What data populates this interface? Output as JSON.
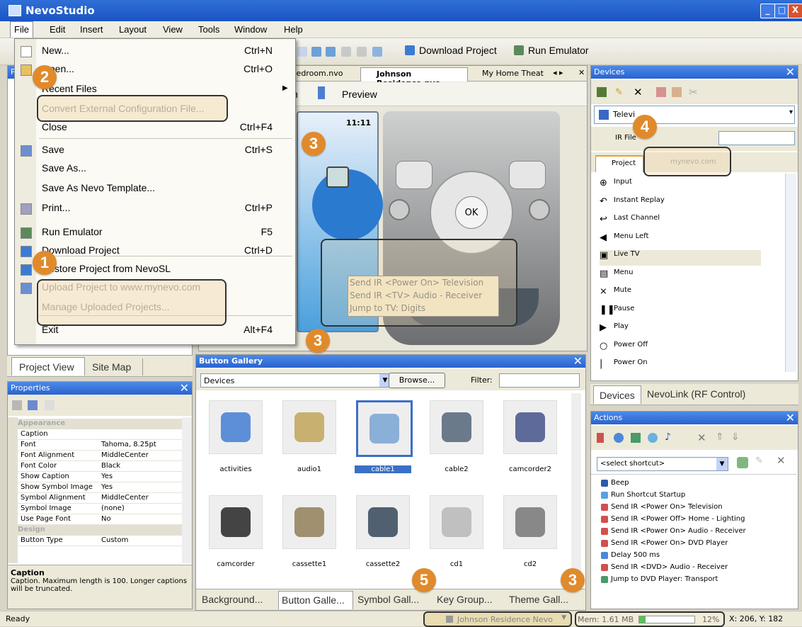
{
  "app": {
    "title": "NevoStudio"
  },
  "window_controls": {
    "minimize": "_",
    "maximize": "□",
    "close": "X"
  },
  "menubar": [
    "File",
    "Edit",
    "Insert",
    "Layout",
    "View",
    "Tools",
    "Window",
    "Help"
  ],
  "toolbar": {
    "download_project": "Download Project",
    "run_emulator": "Run Emulator"
  },
  "file_menu": {
    "items": [
      {
        "label": "New...",
        "shortcut": "Ctrl+N",
        "disabled": false
      },
      {
        "label": "Open...",
        "shortcut": "Ctrl+O",
        "disabled": false
      },
      {
        "label": "Recent Files",
        "shortcut": "",
        "disabled": false
      },
      {
        "label": "Convert External Configuration File...",
        "shortcut": "",
        "disabled": true
      },
      {
        "label": "Close",
        "shortcut": "Ctrl+F4",
        "disabled": false
      },
      {
        "label": "Save",
        "shortcut": "Ctrl+S",
        "disabled": false
      },
      {
        "label": "Save As...",
        "shortcut": "",
        "disabled": false
      },
      {
        "label": "Save As Nevo Template...",
        "shortcut": "",
        "disabled": false
      },
      {
        "label": "Print...",
        "shortcut": "Ctrl+P",
        "disabled": false
      },
      {
        "label": "Run Emulator",
        "shortcut": "F5",
        "disabled": false
      },
      {
        "label": "Download Project",
        "shortcut": "Ctrl+D",
        "disabled": false
      },
      {
        "label": "Restore Project from NevoSL",
        "shortcut": "",
        "disabled": false
      },
      {
        "label": "Upload Project to www.mynevo.com",
        "shortcut": "",
        "disabled": true
      },
      {
        "label": "Manage Uploaded Projects...",
        "shortcut": "",
        "disabled": true
      },
      {
        "label": "Exit",
        "shortcut": "Alt+F4",
        "disabled": false
      }
    ]
  },
  "badges": {
    "one": "1",
    "two": "2",
    "three": "3",
    "four": "4",
    "five": "5"
  },
  "editor": {
    "tabs": [
      "y Bedroom.nvo",
      "Johnson Residence.nvo",
      "My Home Theat"
    ],
    "view_tabs": {
      "design": "wn",
      "preview": "Preview"
    },
    "screen_time": "11:11",
    "ok_label": "OK",
    "tooltip_lines": [
      "Send IR <Power On> Television",
      "Send IR <TV> Audio - Receiver",
      "Jump to TV: Digits"
    ]
  },
  "left_panel": {
    "tabs": [
      "Project View",
      "Site Map"
    ],
    "title_fragment": "Pr"
  },
  "properties": {
    "title": "Properties",
    "rows": [
      {
        "key": "Appearance",
        "value": "",
        "category": true
      },
      {
        "key": "Caption",
        "value": "",
        "category": false
      },
      {
        "key": "Font",
        "value": "Tahoma, 8.25pt",
        "category": false
      },
      {
        "key": "Font Alignment",
        "value": "MiddleCenter",
        "category": false
      },
      {
        "key": "Font Color",
        "value": "Black",
        "category": false
      },
      {
        "key": "Show Caption",
        "value": "Yes",
        "category": false
      },
      {
        "key": "Show Symbol Image",
        "value": "Yes",
        "category": false
      },
      {
        "key": "Symbol Alignment",
        "value": "MiddleCenter",
        "category": false
      },
      {
        "key": "Symbol Image",
        "value": "(none)",
        "category": false
      },
      {
        "key": "Use Page Font",
        "value": "No",
        "category": false
      },
      {
        "key": "Design",
        "value": "",
        "category": true
      },
      {
        "key": "Button Type",
        "value": "Custom",
        "category": false
      }
    ],
    "help_title": "Caption",
    "help_text": "Caption. Maximum length is 100. Longer captions will be truncated."
  },
  "gallery": {
    "title": "Button Gallery",
    "category": "Devices",
    "browse_label": "Browse...",
    "filter_label": "Filter:",
    "items": [
      "activities",
      "audio1",
      "cable1",
      "cable2",
      "camcorder2",
      "camcorder",
      "cassette1",
      "cassette2",
      "cd1",
      "cd2"
    ],
    "selected": "cable1",
    "bottom_tabs": [
      "Background...",
      "Button Galle...",
      "Symbol Gall...",
      "Key Group...",
      "Theme Gall..."
    ]
  },
  "devices": {
    "title": "Devices",
    "selected_device": "Televi",
    "ir_file_label": "IR File",
    "tabs": [
      "Project",
      "mynevo.com"
    ],
    "symbols": [
      "Input",
      "Instant Replay",
      "Last Channel",
      "Menu Left",
      "Live TV",
      "Menu",
      "Mute",
      "Pause",
      "Play",
      "Power Off",
      "Power On"
    ],
    "bottom_tabs": [
      "Devices",
      "NevoLink (RF Control)"
    ]
  },
  "actions": {
    "title": "Actions",
    "shortcut_placeholder": "<select shortcut>",
    "items": [
      "Beep",
      "Run Shortcut Startup",
      "Send IR <Power On> Television",
      "Send IR <Power Off> Home - Lighting",
      "Send IR <Power On> Audio - Receiver",
      "Send IR <Power On> DVD Player",
      "Delay 500 ms",
      "Send IR <DVD> Audio - Receiver",
      "Jump to DVD Player: Transport"
    ]
  },
  "status": {
    "ready": "Ready",
    "project": "Johnson Residence Nevo",
    "memory": "Mem: 1.61 MB",
    "memory_percent": "12%",
    "memory_fraction": 0.12,
    "coords": "X: 206, Y: 182"
  }
}
